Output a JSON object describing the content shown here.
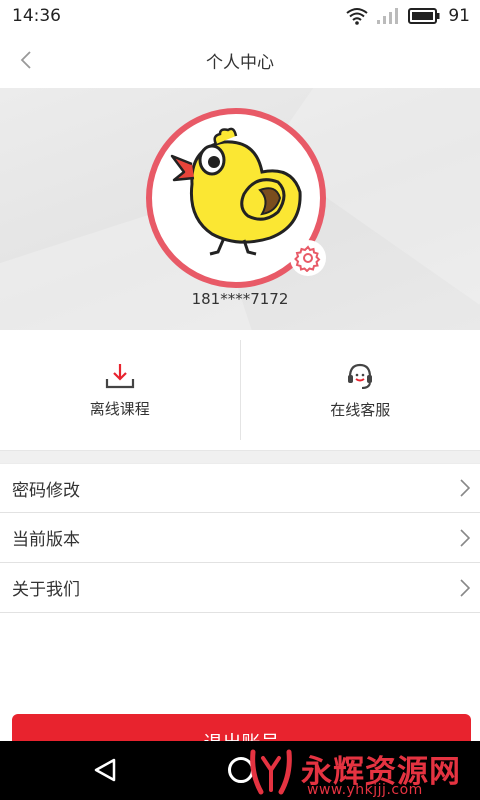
{
  "status_bar": {
    "time": "14:36",
    "battery": "91"
  },
  "nav": {
    "title": "个人中心"
  },
  "profile": {
    "phone": "181****7172"
  },
  "shortcuts": [
    {
      "label": "离线课程",
      "icon": "download-icon"
    },
    {
      "label": "在线客服",
      "icon": "headset-icon"
    }
  ],
  "menu": [
    {
      "label": "密码修改"
    },
    {
      "label": "当前版本"
    },
    {
      "label": "关于我们"
    }
  ],
  "logout_label": "退出账号",
  "watermark": {
    "text": "永辉资源网",
    "url": "www.yhkjjj.com"
  },
  "colors": {
    "accent": "#e8232e",
    "avatar_ring": "#e85a67"
  }
}
